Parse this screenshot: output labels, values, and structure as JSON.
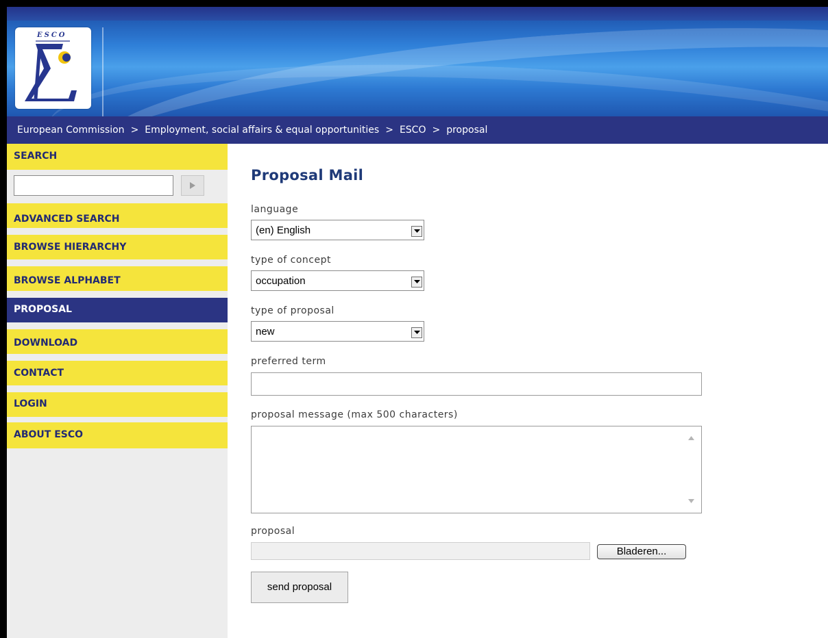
{
  "logo": {
    "label": "ESCO"
  },
  "breadcrumb": {
    "items": [
      "European Commission",
      "Employment, social affairs & equal opportunities",
      "ESCO",
      "proposal"
    ],
    "separator": ">"
  },
  "sidebar": {
    "search_label": "SEARCH",
    "search_value": "",
    "items": [
      {
        "label": "ADVANCED SEARCH"
      },
      {
        "label": "BROWSE HIERARCHY"
      },
      {
        "label": "BROWSE ALPHABET"
      },
      {
        "label": "PROPOSAL",
        "active": true
      },
      {
        "label": "DOWNLOAD"
      },
      {
        "label": "CONTACT"
      },
      {
        "label": "LOGIN"
      },
      {
        "label": "ABOUT ESCO"
      }
    ]
  },
  "form": {
    "title": "Proposal Mail",
    "language_label": "language",
    "language_value": "(en) English",
    "concept_label": "type of concept",
    "concept_value": "occupation",
    "proposal_type_label": "type of proposal",
    "proposal_type_value": "new",
    "preferred_term_label": "preferred term",
    "preferred_term_value": "",
    "message_label": "proposal message (max 500 characters)",
    "message_value": "",
    "file_label": "proposal",
    "browse_label": "Bladeren...",
    "send_label": "send proposal"
  },
  "colors": {
    "nav_bg": "#2b3483",
    "menu_yellow": "#f5e43c",
    "sidebar_bg": "#ededed",
    "title_blue": "#1f3a78"
  }
}
